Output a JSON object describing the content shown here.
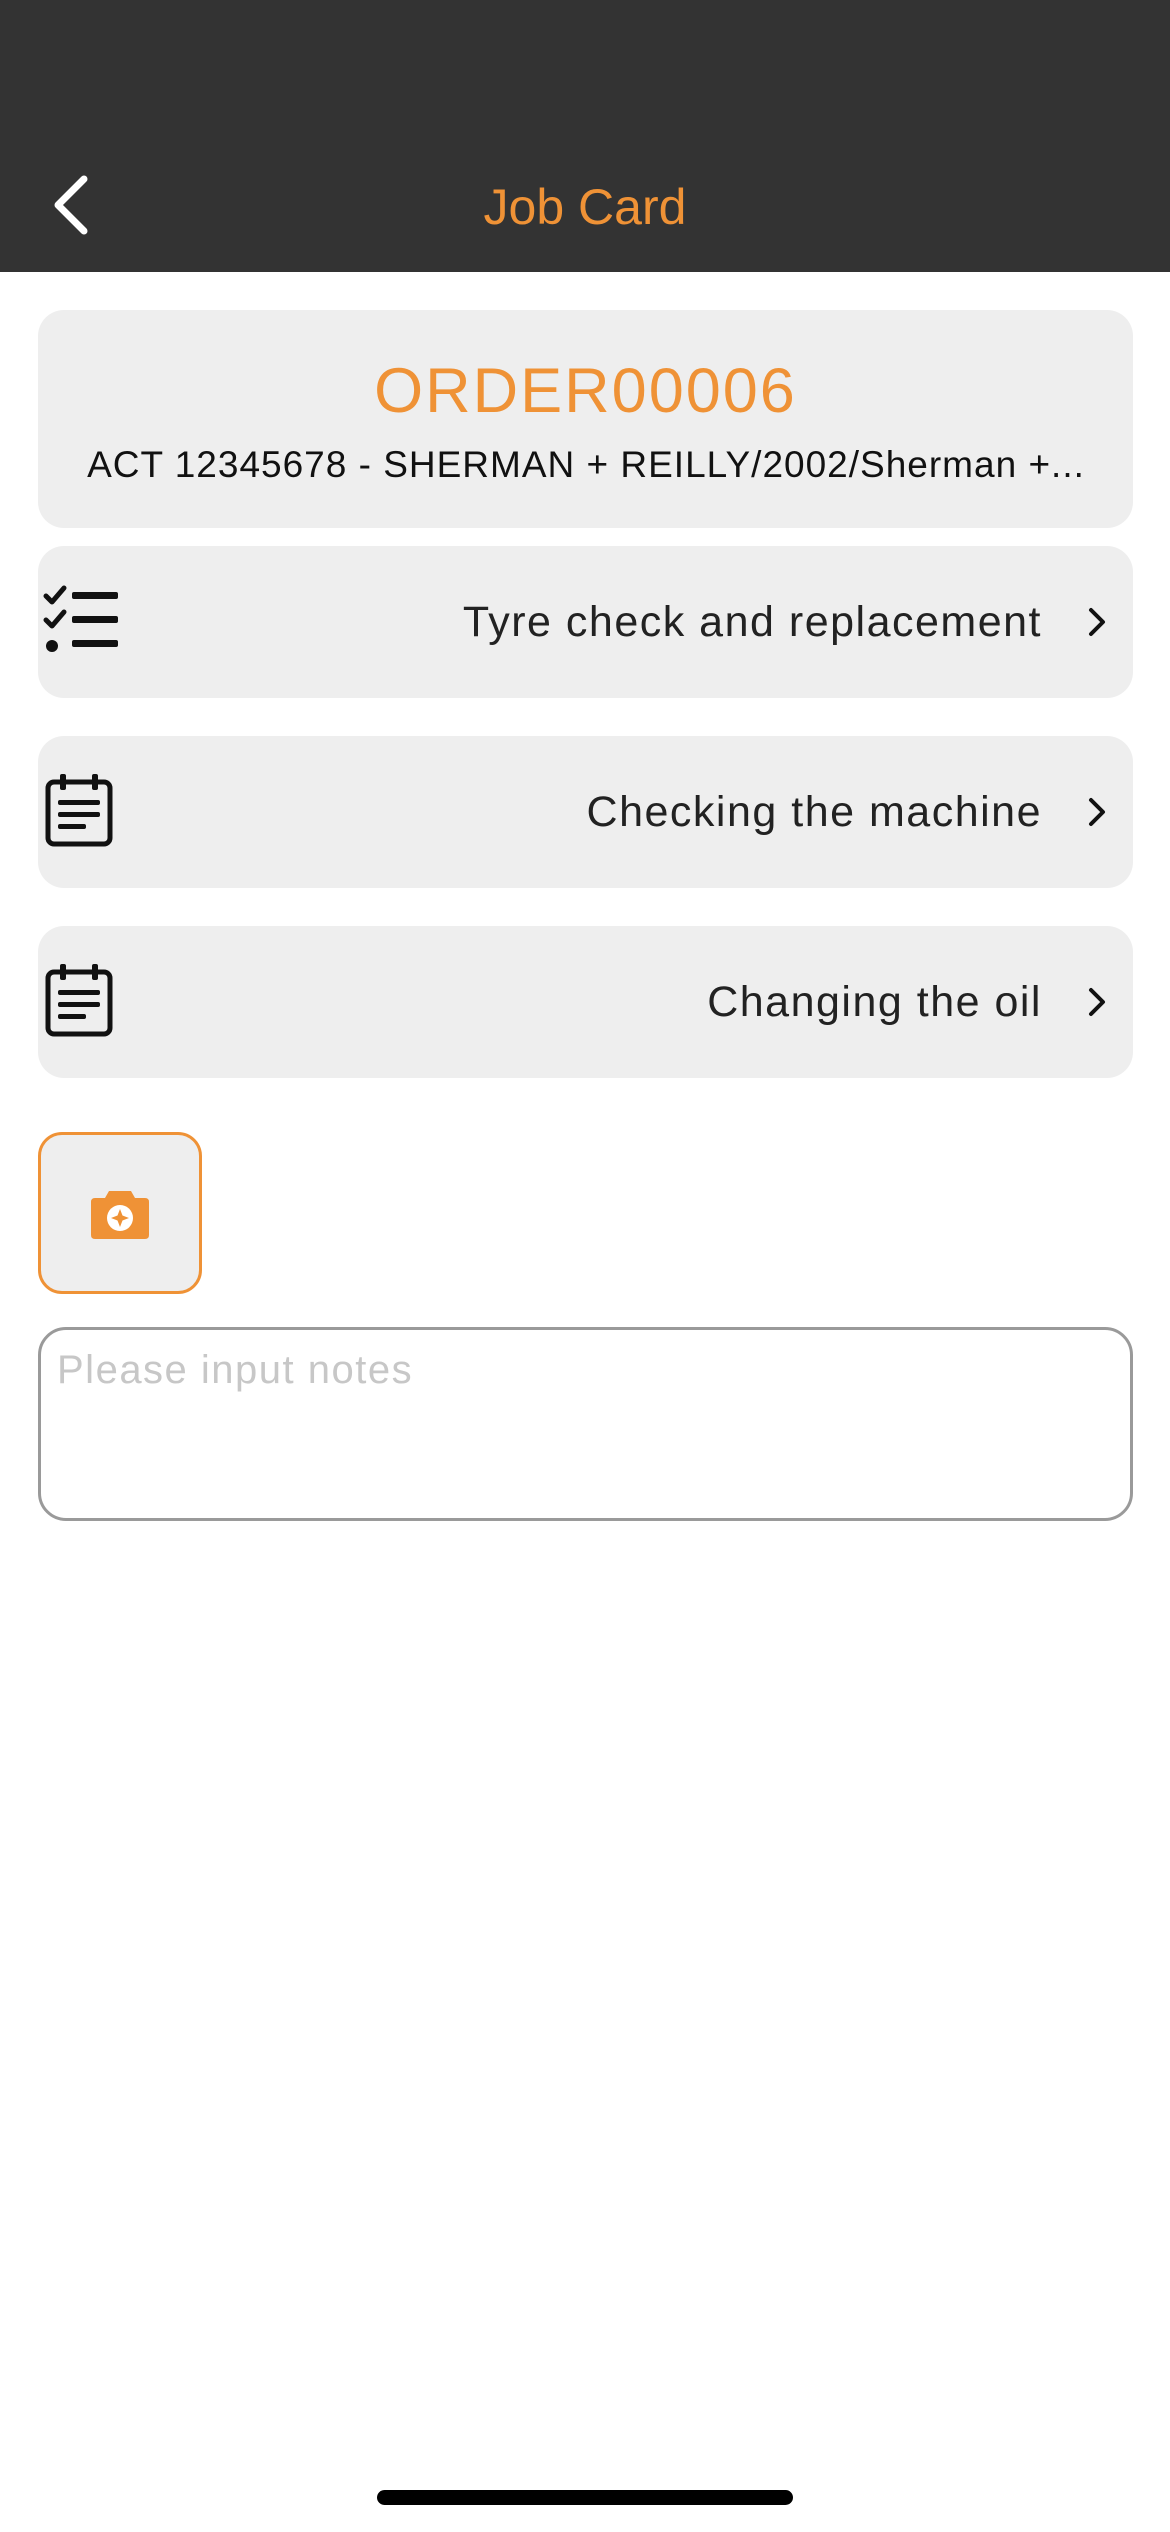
{
  "colors": {
    "accent": "#ef9236",
    "nav_background": "#333333",
    "card_background": "#eeeeee"
  },
  "header": {
    "title": "Job Card",
    "back_icon": "chevron-left-icon"
  },
  "order": {
    "number": "ORDER00006",
    "subtitle": "ACT 12345678 - SHERMAN + REILLY/2002/Sherman +..."
  },
  "tasks": [
    {
      "label": "Tyre check and replacement",
      "icon": "checklist-icon"
    },
    {
      "label": "Checking the machine",
      "icon": "calendar-notes-icon"
    },
    {
      "label": "Changing the oil",
      "icon": "calendar-notes-icon"
    }
  ],
  "camera": {
    "icon": "camera-icon"
  },
  "notes": {
    "placeholder": "Please input notes",
    "value": ""
  }
}
